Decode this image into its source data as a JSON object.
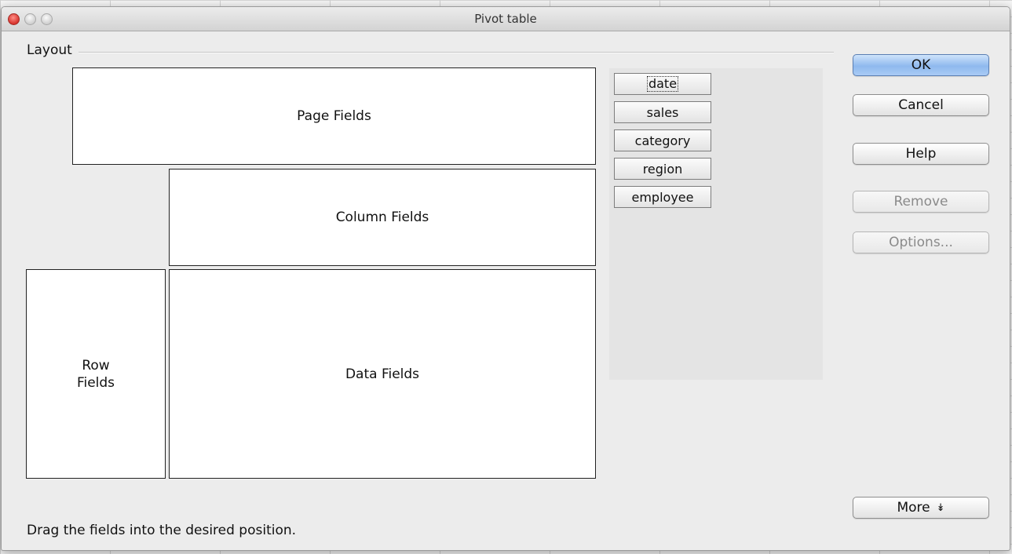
{
  "window": {
    "title": "Pivot table"
  },
  "layout": {
    "section_label": "Layout",
    "page_fields": "Page Fields",
    "column_fields": "Column Fields",
    "row_fields": "Row\nFields",
    "data_fields": "Data Fields"
  },
  "fields": [
    "date",
    "sales",
    "category",
    "region",
    "employee"
  ],
  "buttons": {
    "ok": "OK",
    "cancel": "Cancel",
    "help": "Help",
    "remove": "Remove",
    "options": "Options...",
    "more": "More",
    "more_icon": "double-chevron-down-icon"
  },
  "hint": "Drag the fields into the desired position.",
  "colors": {
    "default_button": "#8fb9ee",
    "close_button": "#d6322c",
    "disabled_text": "#8a8a8a"
  }
}
